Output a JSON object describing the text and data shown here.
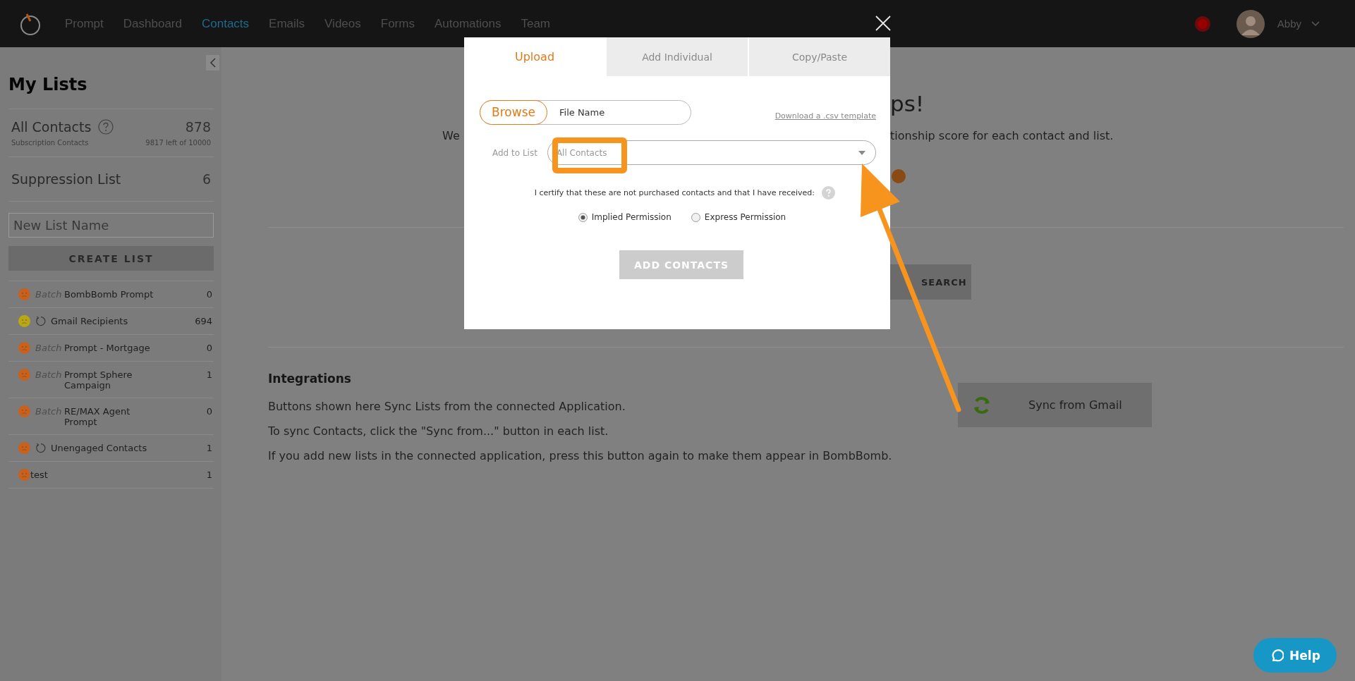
{
  "nav": {
    "items": [
      {
        "label": "Prompt",
        "selected": false
      },
      {
        "label": "Dashboard",
        "selected": false
      },
      {
        "label": "Contacts",
        "selected": true
      },
      {
        "label": "Emails",
        "selected": false
      },
      {
        "label": "Videos",
        "selected": false
      },
      {
        "label": "Forms",
        "selected": false
      },
      {
        "label": "Automations",
        "selected": false
      },
      {
        "label": "Team",
        "selected": false
      }
    ],
    "user": {
      "name": "Abby"
    }
  },
  "sidebar": {
    "title": "My Lists",
    "all_contacts": {
      "label": "All Contacts",
      "count": "878",
      "sublabel": "Subscription Contacts",
      "quota": "9817 left of 10000"
    },
    "suppression": {
      "label": "Suppression List",
      "count": "6"
    },
    "new_list": {
      "placeholder": "New List Name"
    },
    "create_button": "CREATE LIST",
    "lists": [
      {
        "kind": "batch",
        "color": "#c8611d",
        "tag": "Batch",
        "name": "BombBomb Prompt",
        "count": "0"
      },
      {
        "kind": "sync",
        "color": "#b9a815",
        "name": "Gmail Recipients",
        "count": "694"
      },
      {
        "kind": "batch",
        "color": "#c8611d",
        "tag": "Batch",
        "name": "Prompt - Mortgage",
        "count": "0"
      },
      {
        "kind": "batch",
        "color": "#c8611d",
        "tag": "Batch",
        "name": "Prompt Sphere Campaign",
        "count": "1"
      },
      {
        "kind": "batch",
        "color": "#c8611d",
        "tag": "Batch",
        "name": "RE/MAX Agent Prompt",
        "count": "0"
      },
      {
        "kind": "sync",
        "color": "#c8611d",
        "name": "Unengaged Contacts",
        "count": "1"
      },
      {
        "kind": "plain",
        "color": "#c8611d",
        "name": "test",
        "count": "1"
      }
    ]
  },
  "main": {
    "heading": "ps!",
    "intro": [
      "We",
      "tionship score for each contact and list."
    ],
    "search_button": "SEARCH",
    "integrations": {
      "title": "Integrations",
      "lines": [
        "Buttons shown here Sync Lists from the connected Application.",
        "To sync Contacts, click the \"Sync from...\" button in each list.",
        "If you add new lists in the connected application, press this button again to make them appear in BombBomb."
      ],
      "sync_button": "Sync from Gmail"
    }
  },
  "modal": {
    "tabs": [
      {
        "label": "Upload",
        "selected": true
      },
      {
        "label": "Add Individual",
        "selected": false
      },
      {
        "label": "Copy/Paste",
        "selected": false
      }
    ],
    "browse_button": "Browse",
    "file_field": {
      "value": "File Name"
    },
    "template_link": "Download a .csv template",
    "add_to_list": {
      "label": "Add to List",
      "value": "All Contacts"
    },
    "certify": "I certify that these are not purchased contacts and that I have received:",
    "permissions": [
      {
        "label": "Implied Permission",
        "selected": true
      },
      {
        "label": "Express Permission",
        "selected": false
      }
    ],
    "submit": {
      "label": "ADD CONTACTS",
      "disabled": true
    }
  },
  "help_button": "Help"
}
